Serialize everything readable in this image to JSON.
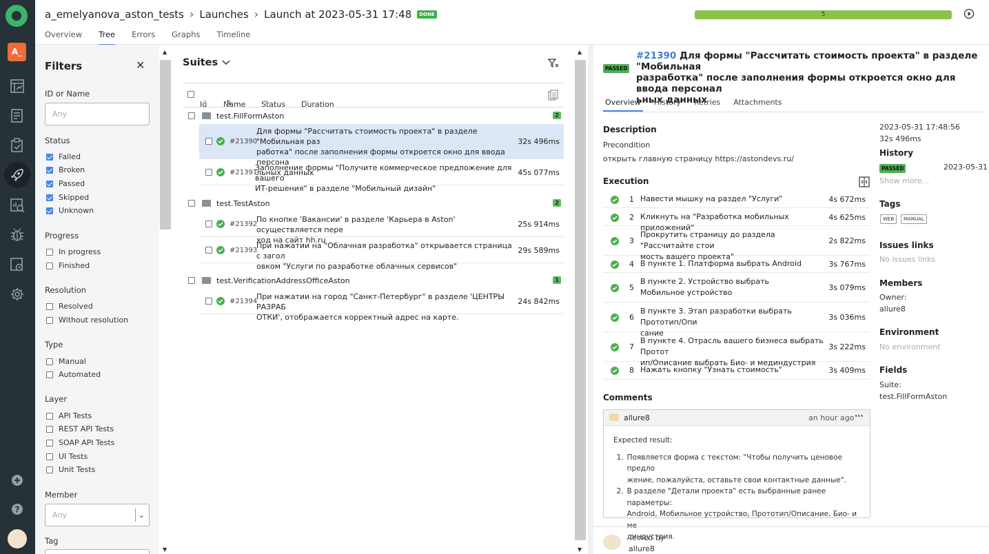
{
  "project_badge": "A_",
  "breadcrumb": {
    "project": "a_emelyanova_aston_tests",
    "launches": "Launches",
    "launch": "Launch at 2023-05-31 17:48",
    "badge": "DONE"
  },
  "tabs": [
    "Overview",
    "Tree",
    "Errors",
    "Graphs",
    "Timeline"
  ],
  "progress": {
    "count": "5",
    "fraction": 1.0,
    "color": "#8bc34a"
  },
  "filters": {
    "title": "Filters",
    "id_label": "ID or Name",
    "id_placeholder": "Any",
    "status_label": "Status",
    "status": [
      {
        "label": "Failed",
        "checked": true
      },
      {
        "label": "Broken",
        "checked": true
      },
      {
        "label": "Passed",
        "checked": true
      },
      {
        "label": "Skipped",
        "checked": true
      },
      {
        "label": "Unknown",
        "checked": true
      }
    ],
    "progress_label": "Progress",
    "progress": [
      "In progress",
      "Finished"
    ],
    "resolution_label": "Resolution",
    "resolution": [
      "Resolved",
      "Without resolution"
    ],
    "type_label": "Type",
    "type": [
      "Manual",
      "Automated"
    ],
    "layer_label": "Layer",
    "layer": [
      "API Tests",
      "REST API Tests",
      "SOAP API Tests",
      "UI Tests",
      "Unit Tests"
    ],
    "member_label": "Member",
    "member_placeholder": "Any",
    "tag_label": "Tag"
  },
  "tree": {
    "title": "Suites",
    "columns": [
      "Id",
      "Name",
      "Status",
      "Duration"
    ],
    "groups": [
      {
        "name": "test.FillFormAston",
        "count": "2",
        "rows": [
          {
            "id": "#21390",
            "line1": "Для формы \"Рассчитать стоимость проекта\" в разделе \"Мобильная раз",
            "line2": "работка\" после заполнения формы откроется окно для ввода персона",
            "line3": "льных данных",
            "duration": "32s 496ms"
          },
          {
            "id": "#21391",
            "line1": "Заполнение формы \"Получите коммерческое предложение для вашего",
            "line2": "ИТ-решения\" в разделе \"Мобильный дизайн\"",
            "duration": "45s 077ms"
          }
        ]
      },
      {
        "name": "test.TestAston",
        "count": "2",
        "rows": [
          {
            "id": "#21392",
            "line1": "По кнопке 'Вакансии' в разделе 'Карьера в Aston' осуществляется пере",
            "line2": "ход на сайт hh.ru",
            "duration": "25s 914ms"
          },
          {
            "id": "#21393",
            "line1": "При нажатии на \"Облачная разработка\" открывается страница с загол",
            "line2": "овком \"Услуги по разработке облачных сервисов\"",
            "duration": "29s 589ms"
          }
        ]
      },
      {
        "name": "test.VerificationAddressOfficeAston",
        "count": "1",
        "rows": [
          {
            "id": "#21394",
            "line1": "При нажатии на город \"Санкт-Петербург\" в разделе 'ЦЕНТРЫ РАЗРАБ",
            "line2": "ОТКИ', отображается корректный адрес на карте.",
            "duration": "24s 842ms"
          }
        ]
      }
    ]
  },
  "details": {
    "status": "PASSED",
    "number": "#21390",
    "title_line1": "Для формы \"Рассчитать стоимость проекта\" в разделе \"Мобильная",
    "title_line2": "разработка\" после заполнения формы откроется окно для ввода персонал",
    "title_line3": "ьных данных",
    "tabs": [
      "Overview",
      "History",
      "Retries",
      "Attachments"
    ],
    "description_label": "Description",
    "precondition_label": "Precondition",
    "precondition_text": "открыть главную страницу https://astondevs.ru/",
    "execution_label": "Execution",
    "steps": [
      {
        "n": "1",
        "l1": "Навести мышку на раздел \"Услуги\"",
        "d": "4s 672ms"
      },
      {
        "n": "2",
        "l1": "Кликнуть на \"Разработка мобильных приложений\"",
        "d": "4s 625ms"
      },
      {
        "n": "3",
        "l1": "Прокрутить страницу до раздела \"Рассчитайте стои",
        "l2": "мость вашего проекта\"",
        "d": "2s 822ms"
      },
      {
        "n": "4",
        "l1": "В пункте 1. Платформа выбрать Android",
        "d": "3s 767ms"
      },
      {
        "n": "5",
        "l1": "В пункте 2. Устройство выбрать",
        "l2": "Мобильное устройство",
        "d": "3s 079ms"
      },
      {
        "n": "6",
        "l1": "В пункте 3. Этап разработки выбрать Прототип/Опи",
        "l2": "сание",
        "d": "3s 036ms"
      },
      {
        "n": "7",
        "l1": "В пункте 4. Отрасль вашего бизнеса выбрать Протот",
        "l2": "ип/Описание выбрать Био- и мединдустрия",
        "d": "3s 222ms"
      },
      {
        "n": "8",
        "l1": "Нажать кнопку \"Узнать стоимость\"",
        "d": "3s 409ms"
      }
    ],
    "comments_label": "Comments",
    "comment": {
      "author": "allure8",
      "time": "an hour ago",
      "menu": "···",
      "heading": "Expected result:",
      "item1_l1": "Появляется форма с текстом: \"Чтобы получить ценовое предло",
      "item1_l2": "жение, пожалуйста, оставьте свои контактные данные\".",
      "item2_l1": "В разделе \"Детали проекта\" есть выбранные ранее параметры:",
      "item2_l2": "Android, Мобильное устройство, Прототип/Описание, Био- и ме",
      "item2_l3": "диндустрия."
    },
    "side": {
      "date": "2023-05-31 17:48:56",
      "duration": "32s 496ms",
      "history_label": "History",
      "history_status": "PASSED",
      "history_date": "2023-05-31",
      "show_more": "Show more...",
      "tags_label": "Tags",
      "tags": [
        "WEB",
        "MANUAL"
      ],
      "issues_label": "Issues links",
      "issues_value": "No issues links",
      "members_label": "Members",
      "owner_label": "Owner:",
      "owner": "allure8",
      "env_label": "Environment",
      "env_value": "No environment",
      "fields_label": "Fields",
      "suite_label": "Suite:",
      "suite": "test.FillFormAston"
    },
    "tested_by_label": "Tested by",
    "tested_by": "allure8"
  }
}
